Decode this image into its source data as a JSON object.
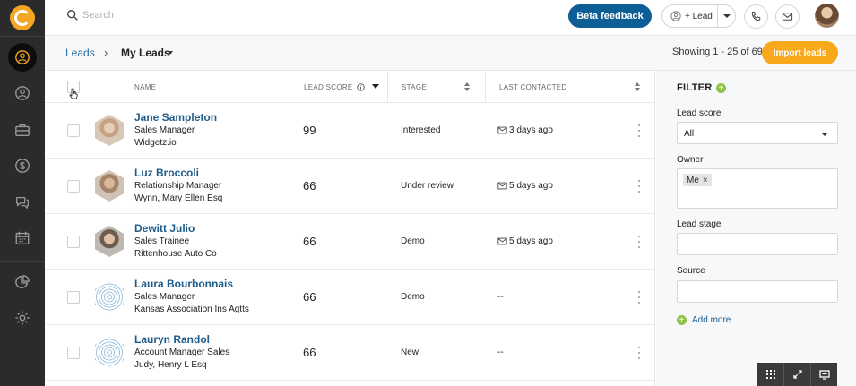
{
  "search": {
    "placeholder": "Search"
  },
  "topbar": {
    "beta_feedback": "Beta feedback",
    "add_lead": "+ Lead"
  },
  "breadcrumb": {
    "root": "Leads",
    "separator": "›",
    "current": "My Leads"
  },
  "pagination": {
    "showing": "Showing 1 - 25 of 69"
  },
  "import_button": "Import leads",
  "table": {
    "headers": {
      "name": "NAME",
      "lead_score": "LEAD SCORE",
      "stage": "STAGE",
      "last_contacted": "LAST CONTACTED"
    },
    "rows": [
      {
        "name": "Jane Sampleton",
        "title": "Sales Manager",
        "company": "Widgetz.io",
        "score": "99",
        "stage": "Interested",
        "last_contacted": "3 days ago"
      },
      {
        "name": "Luz Broccoli",
        "title": "Relationship Manager",
        "company": "Wynn, Mary Ellen Esq",
        "score": "66",
        "stage": "Under review",
        "last_contacted": "5 days ago"
      },
      {
        "name": "Dewitt Julio",
        "title": "Sales Trainee",
        "company": "Rittenhouse Auto Co",
        "score": "66",
        "stage": "Demo",
        "last_contacted": "5 days ago"
      },
      {
        "name": "Laura Bourbonnais",
        "title": "Sales Manager",
        "company": "Kansas Association Ins Agtts",
        "score": "66",
        "stage": "Demo",
        "last_contacted": "--"
      },
      {
        "name": "Lauryn Randol",
        "title": "Account Manager Sales",
        "company": "Judy, Henry L Esq",
        "score": "66",
        "stage": "New",
        "last_contacted": "--"
      }
    ]
  },
  "filter": {
    "title": "FILTER",
    "lead_score_label": "Lead score",
    "lead_score_value": "All",
    "owner_label": "Owner",
    "owner_chip": "Me",
    "owner_chip_remove": "×",
    "lead_stage_label": "Lead stage",
    "source_label": "Source",
    "add_more": "Add more",
    "add_icon": "+"
  },
  "colors": {
    "rail": "#2b2b2b",
    "brand_orange": "#f7a81b",
    "primary_blue": "#0d5e95",
    "link_blue": "#1e5c8c",
    "filter_green": "#8fc04a"
  },
  "icons": {
    "rail": [
      "logo-icon",
      "leads-icon",
      "contacts-icon",
      "deals-icon",
      "dollar-icon",
      "chat-icon",
      "calendar-icon",
      "reports-icon",
      "settings-icon"
    ],
    "topbar": [
      "search-icon",
      "user-add-icon",
      "phone-icon",
      "mail-icon"
    ],
    "dock": [
      "apps-grid-icon",
      "expand-icon",
      "screen-icon"
    ]
  }
}
